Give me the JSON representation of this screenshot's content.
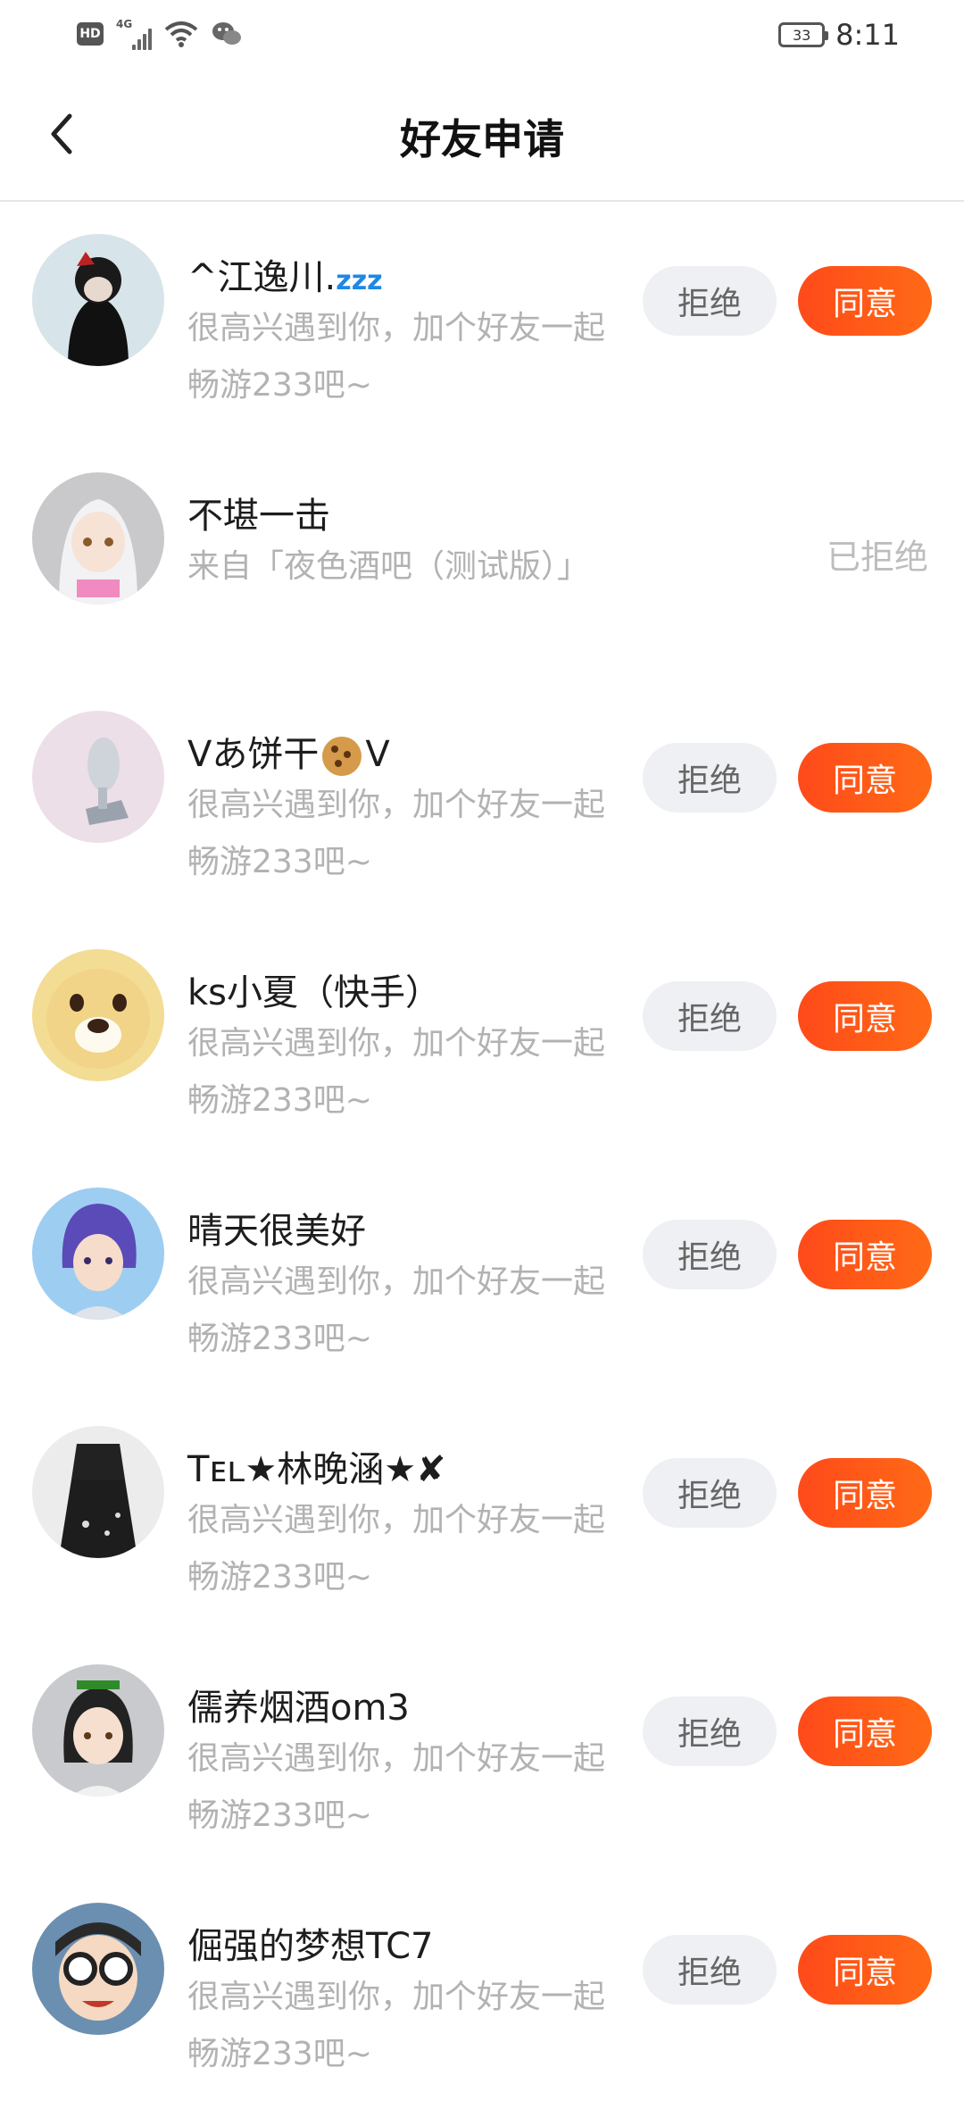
{
  "status_bar": {
    "hd": "HD",
    "network": "4G",
    "battery": "33",
    "time": "8:11"
  },
  "header": {
    "title": "好友申请"
  },
  "actions": {
    "reject": "拒绝",
    "accept": "同意"
  },
  "requests": [
    {
      "name": "^江逸川.",
      "name_suffix": "zzz",
      "message": "很高兴遇到你，加个好友一起畅游233吧~",
      "status": ""
    },
    {
      "name": "不堪一击",
      "message": "来自「夜色酒吧（测试版）」",
      "status": "已拒绝"
    },
    {
      "name_pre": "Vあ饼干",
      "name_post": "V",
      "message": "很高兴遇到你，加个好友一起畅游233吧~",
      "status": ""
    },
    {
      "name": "ks小夏（快手）",
      "message": "很高兴遇到你，加个好友一起畅游233吧~",
      "status": ""
    },
    {
      "name": "晴天很美好",
      "message": "很高兴遇到你，加个好友一起畅游233吧~",
      "status": ""
    },
    {
      "name": "Tᴇʟ★林晚涵★✘",
      "message": "很高兴遇到你，加个好友一起畅游233吧~",
      "status": ""
    },
    {
      "name": "儒养烟酒om3",
      "message": "很高兴遇到你，加个好友一起畅游233吧~",
      "status": ""
    },
    {
      "name": "倔强的梦想TC7",
      "message": "很高兴遇到你，加个好友一起畅游233吧~",
      "status": ""
    }
  ],
  "colors": {
    "accept": "#ff5a18",
    "reject_bg": "#eef0f3",
    "secondary_text": "#b2b2b2"
  }
}
